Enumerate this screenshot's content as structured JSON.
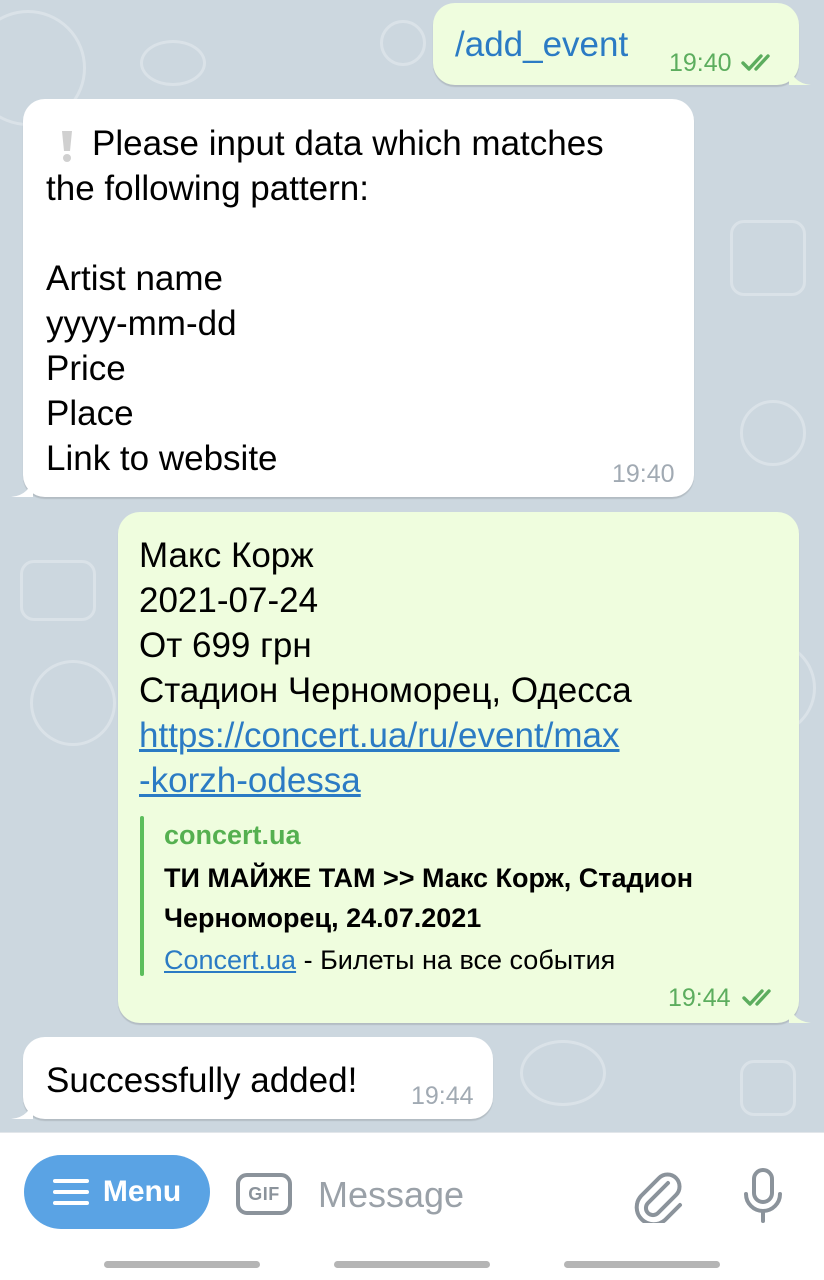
{
  "messages": [
    {
      "direction": "outgoing",
      "text": "/add_event",
      "time": "19:40",
      "status": "read-double-check"
    },
    {
      "direction": "incoming",
      "icon": "exclamation-icon",
      "lines": [
        "Please input data which matches",
        "the following pattern:",
        "",
        "Artist name",
        "yyyy-mm-dd",
        "Price",
        "Place",
        "Link to website"
      ],
      "time": "19:40"
    },
    {
      "direction": "outgoing",
      "lines": [
        "Макс Корж",
        "2021-07-24",
        "От 699 грн",
        "Стадион Черноморец, Одесса"
      ],
      "link_lines": [
        "https://concert.ua/ru/event/max",
        "-korzh-odessa"
      ],
      "preview": {
        "site": "concert.ua",
        "title_lines": [
          "ТИ МАЙЖЕ ТАМ >> Макс Корж, Стадион",
          "Черноморец, 24.07.2021"
        ],
        "desc_link": "Concert.ua",
        "desc_rest": " - Билеты на все события"
      },
      "time": "19:44",
      "status": "read-double-check"
    },
    {
      "direction": "incoming",
      "text": "Successfully added!",
      "time": "19:44"
    }
  ],
  "input_bar": {
    "menu_label": "Menu",
    "gif_label": "GIF",
    "placeholder": "Message"
  },
  "colors": {
    "chat_background": "#ccd7df",
    "outgoing_bubble": "#effdde",
    "incoming_bubble": "#ffffff",
    "link": "#2b7bc4",
    "outgoing_time": "#5cad5e",
    "menu_button": "#5aa3e4"
  }
}
